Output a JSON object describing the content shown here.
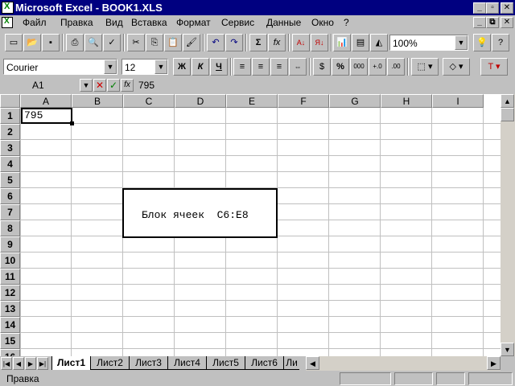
{
  "window": {
    "title": "Microsoft Excel - BOOK1.XLS"
  },
  "menu": {
    "items": [
      "Файл",
      "Правка",
      "Вид",
      "Вставка",
      "Формат",
      "Сервис",
      "Данные",
      "Окно",
      "?"
    ]
  },
  "toolbar_standard": {
    "zoom": "100%"
  },
  "toolbar_format": {
    "font_name": "Courier",
    "font_size": "12",
    "bold_label": "Ж",
    "italic_label": "К",
    "underline_label": "Ч",
    "percent_label": "%",
    "thousands_label": "000"
  },
  "formula_bar": {
    "cell_ref": "A1",
    "value": "795"
  },
  "grid": {
    "columns": [
      "A",
      "B",
      "C",
      "D",
      "E",
      "F",
      "G",
      "H",
      "I"
    ],
    "rows": [
      "1",
      "2",
      "3",
      "4",
      "5",
      "6",
      "7",
      "8",
      "9",
      "10",
      "11",
      "12",
      "13",
      "14",
      "15",
      "16"
    ],
    "cell_a1": "795",
    "block_label": "Блок ячеек  C6:E8"
  },
  "sheets": {
    "tabs": [
      "Лист1",
      "Лист2",
      "Лист3",
      "Лист4",
      "Лист5",
      "Лист6",
      "Ли"
    ],
    "active": "Лист1"
  },
  "status": {
    "text": "Правка"
  }
}
